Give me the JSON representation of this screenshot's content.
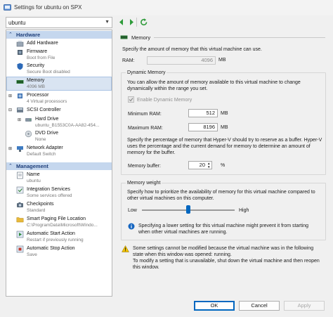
{
  "window": {
    "title": "Settings for ubuntu on SPX"
  },
  "toolbar": {
    "vm_name": "ubuntu"
  },
  "sidebar": {
    "hardware_header": "Hardware",
    "management_header": "Management",
    "hardware_items": [
      {
        "label": "Add Hardware",
        "sub": ""
      },
      {
        "label": "Firmware",
        "sub": "Boot from File"
      },
      {
        "label": "Security",
        "sub": "Secure Boot disabled"
      },
      {
        "label": "Memory",
        "sub": "4096 MB"
      },
      {
        "label": "Processor",
        "sub": "4 Virtual processors"
      },
      {
        "label": "SCSI Controller",
        "sub": ""
      },
      {
        "label": "Hard Drive",
        "sub": "ubuntu_B1553C0A-AA82-454..."
      },
      {
        "label": "DVD Drive",
        "sub": "None"
      },
      {
        "label": "Network Adapter",
        "sub": "Default Switch"
      }
    ],
    "management_items": [
      {
        "label": "Name",
        "sub": "ubuntu"
      },
      {
        "label": "Integration Services",
        "sub": "Some services offered"
      },
      {
        "label": "Checkpoints",
        "sub": "Standard"
      },
      {
        "label": "Smart Paging File Location",
        "sub": "C:\\ProgramData\\Microsoft\\Windo..."
      },
      {
        "label": "Automatic Start Action",
        "sub": "Restart if previously running"
      },
      {
        "label": "Automatic Stop Action",
        "sub": "Save"
      }
    ]
  },
  "memory": {
    "header": "Memory",
    "intro": "Specify the amount of memory that this virtual machine can use.",
    "ram_label": "RAM:",
    "ram_value": "4096",
    "ram_unit": "MB",
    "dynamic": {
      "title": "Dynamic Memory",
      "desc": "You can allow the amount of memory available to this virtual machine to change dynamically within the range you set.",
      "enable_label": "Enable Dynamic Memory",
      "enable_checked": true,
      "min_label": "Minimum RAM:",
      "min_value": "512",
      "max_label": "Maximum RAM:",
      "max_value": "8196",
      "unit": "MB",
      "buffer_desc": "Specify the percentage of memory that Hyper-V should try to reserve as a buffer. Hyper-V uses the percentage and the current demand for memory to determine an amount of memory for the buffer.",
      "buffer_label": "Memory buffer:",
      "buffer_value": "20",
      "buffer_unit": "%"
    },
    "weight": {
      "title": "Memory weight",
      "desc": "Specify how to prioritize the availability of memory for this virtual machine compared to other virtual machines on this computer.",
      "low_label": "Low",
      "high_label": "High",
      "slider_fraction": 0.5,
      "info": "Specifying a lower setting for this virtual machine might prevent it from starting when other virtual machines are running."
    },
    "warning": "Some settings cannot be modified because the virtual machine was in the following state when this window was opened: running.\nTo modify a setting that is unavailable, shut down the virtual machine and then reopen this window."
  },
  "buttons": {
    "ok": "OK",
    "cancel": "Cancel",
    "apply": "Apply"
  },
  "colors": {
    "accent": "#0067c0",
    "selected_bg": "#d9e4f2",
    "section_bg": "#c5d7ee"
  }
}
